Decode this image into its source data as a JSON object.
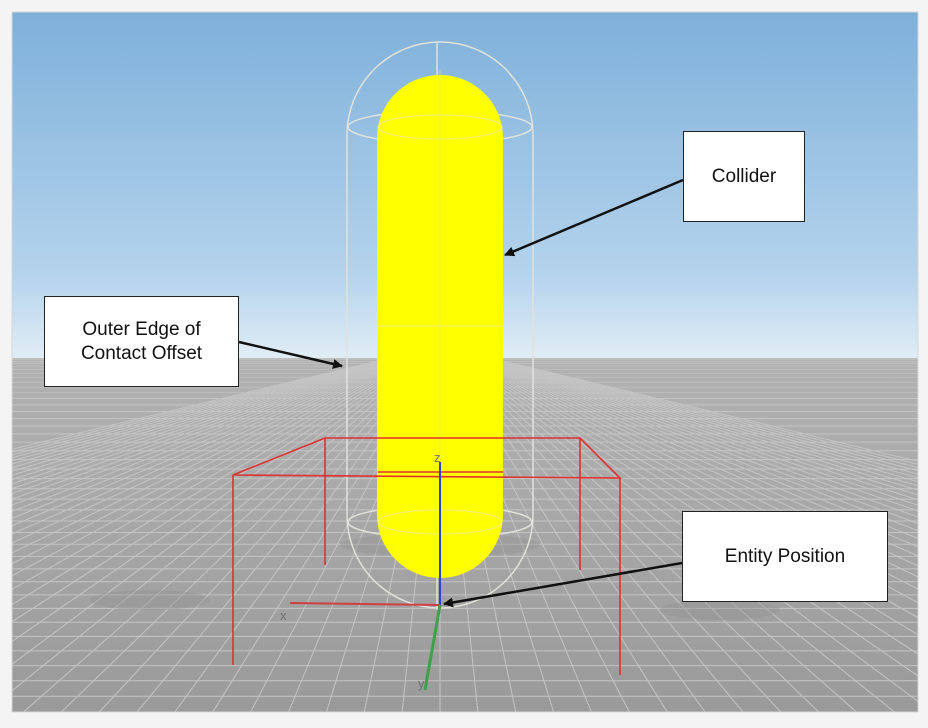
{
  "callouts": {
    "collider": "Collider",
    "contact_offset": "Outer Edge of\nContact Offset",
    "entity_position": "Entity Position"
  },
  "axes": {
    "x": "x",
    "y": "y",
    "z": "z"
  },
  "colors": {
    "sky_top": "#7eb0da",
    "sky_horizon": "#dceaf4",
    "ground": "#a2a2a2",
    "grid": "#c4c4c4",
    "collider": "#ffff00",
    "contact_offset_outline": "#e2e2da",
    "bounding_box": "#e03030",
    "axis_x": "#d04040",
    "axis_y": "#3fa04a",
    "axis_z": "#3040d8"
  }
}
